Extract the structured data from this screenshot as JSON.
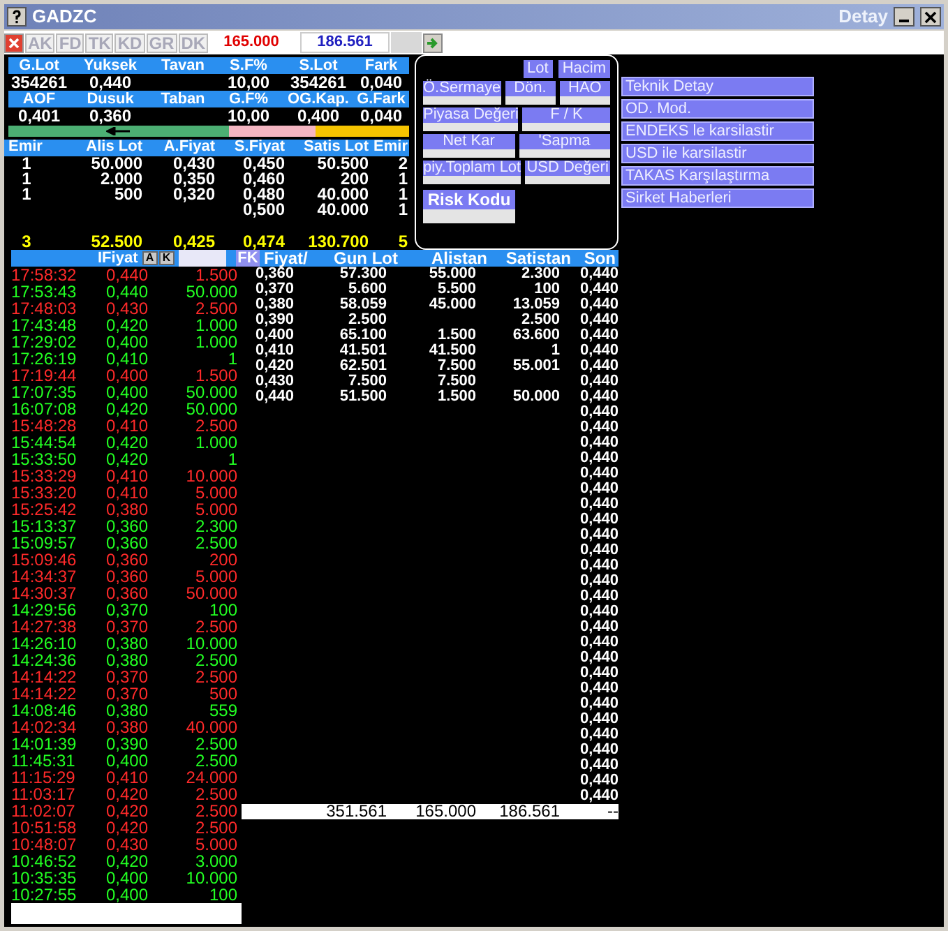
{
  "window": {
    "title": "GADZC",
    "subtitle": "Detay"
  },
  "toolbar": {
    "buttons": [
      {
        "label": "AK",
        "disabled": true
      },
      {
        "label": "FD",
        "disabled": true
      },
      {
        "label": "TK",
        "disabled": true
      },
      {
        "label": "KD",
        "disabled": true
      },
      {
        "label": "GR",
        "disabled": true
      },
      {
        "label": "DK",
        "disabled": true
      }
    ],
    "sell_total": "165.000",
    "buy_total": "186.561"
  },
  "summary": [
    {
      "columns": [
        {
          "header": "G.Lot",
          "value": "354261"
        },
        {
          "header": "Yuksek",
          "value": "0,440"
        },
        {
          "header": "Tavan"
        },
        {
          "header": "S.F%",
          "value": "10,00"
        },
        {
          "header": "S.Lot",
          "value": "354261"
        },
        {
          "header": "Fark",
          "value": "0,040"
        }
      ]
    },
    {
      "columns": [
        {
          "header": "AOF",
          "value": "0,401"
        },
        {
          "header": "Dusuk",
          "value": "0,360"
        },
        {
          "header": "Taban"
        },
        {
          "header": "G.F%",
          "value": "10,00"
        },
        {
          "header": "OG.Kap.",
          "value": "0,400"
        },
        {
          "header": "G.Fark",
          "value": "0,040"
        }
      ]
    }
  ],
  "range_bar": {
    "segments": [
      {
        "color": "#4caf73"
      },
      {
        "color": "#f4b6c2"
      },
      {
        "color": "#f5c400"
      }
    ]
  },
  "order_book": {
    "columns": [
      "Emir",
      "Alis Lot",
      "A.Fiyat",
      "S.Fiyat",
      "Satis Lot",
      "Emir"
    ],
    "rows": [
      {
        "buy_orders": "1",
        "buy_lot": "50.000",
        "buy_price": "0,430",
        "sell_price": "0,450",
        "sell_lot": "50.500",
        "sell_orders": "2"
      },
      {
        "buy_orders": "1",
        "buy_lot": "2.000",
        "buy_price": "0,350",
        "sell_price": "0,460",
        "sell_lot": "200",
        "sell_orders": "1"
      },
      {
        "buy_orders": "1",
        "buy_lot": "500",
        "buy_price": "0,320",
        "sell_price": "0,480",
        "sell_lot": "40.000",
        "sell_orders": "1"
      },
      {
        "sell_price": "0,500",
        "sell_lot": "40.000",
        "sell_orders": "1"
      }
    ],
    "totals": [
      "3",
      "52.500",
      "0,425",
      "0,474",
      "130.700",
      "5"
    ]
  },
  "detail_panel": {
    "buttons": [
      "Lot",
      "Hacim"
    ],
    "rows": [
      [
        {
          "label": "Ö.Sermaye"
        },
        {
          "label": "Dön."
        },
        {
          "label": "HAO"
        }
      ],
      [
        {
          "label": "Piyasa Değeri"
        },
        {
          "label": "F / K"
        }
      ],
      [
        {
          "label": "Net Kar"
        },
        {
          "label": "'Sapma"
        }
      ],
      [
        {
          "label": "piy.Toplam Lot"
        },
        {
          "label": "USD Değeri"
        }
      ],
      [
        {
          "label": "Risk Kodu"
        }
      ]
    ]
  },
  "menu": [
    "Teknik Detay",
    "OD. Mod.",
    "ENDEKS le karsilastir",
    "USD ile karsilastir",
    "TAKAS Karşılaştırma",
    "Sirket Haberleri"
  ],
  "trades": {
    "header": "IFiyat",
    "buttons": [
      "A",
      "K"
    ],
    "filter_button": "FK",
    "rows": [
      {
        "time": "17:58:32",
        "price": "0,440",
        "qty": "1.500",
        "color": "#ff2a2a"
      },
      {
        "time": "17:53:43",
        "price": "0,440",
        "qty": "50.000",
        "color": "#22ff22"
      },
      {
        "time": "17:48:03",
        "price": "0,430",
        "qty": "2.500",
        "color": "#ff2a2a"
      },
      {
        "time": "17:43:48",
        "price": "0,420",
        "qty": "1.000",
        "color": "#22ff22"
      },
      {
        "time": "17:29:02",
        "price": "0,400",
        "qty": "1.000",
        "color": "#22ff22"
      },
      {
        "time": "17:26:19",
        "price": "0,410",
        "qty": "1",
        "color": "#22ff22"
      },
      {
        "time": "17:19:44",
        "price": "0,400",
        "qty": "1.500",
        "color": "#ff2a2a"
      },
      {
        "time": "17:07:35",
        "price": "0,400",
        "qty": "50.000",
        "color": "#22ff22"
      },
      {
        "time": "16:07:08",
        "price": "0,420",
        "qty": "50.000",
        "color": "#22ff22"
      },
      {
        "time": "15:48:28",
        "price": "0,410",
        "qty": "2.500",
        "color": "#ff2a2a"
      },
      {
        "time": "15:44:54",
        "price": "0,420",
        "qty": "1.000",
        "color": "#22ff22"
      },
      {
        "time": "15:33:50",
        "price": "0,420",
        "qty": "1",
        "color": "#22ff22"
      },
      {
        "time": "15:33:29",
        "price": "0,410",
        "qty": "10.000",
        "color": "#ff2a2a"
      },
      {
        "time": "15:33:20",
        "price": "0,410",
        "qty": "5.000",
        "color": "#ff2a2a"
      },
      {
        "time": "15:25:42",
        "price": "0,380",
        "qty": "5.000",
        "color": "#ff2a2a"
      },
      {
        "time": "15:13:37",
        "price": "0,360",
        "qty": "2.300",
        "color": "#22ff22"
      },
      {
        "time": "15:09:57",
        "price": "0,360",
        "qty": "2.500",
        "color": "#22ff22"
      },
      {
        "time": "15:09:46",
        "price": "0,360",
        "qty": "200",
        "color": "#ff2a2a"
      },
      {
        "time": "14:34:37",
        "price": "0,360",
        "qty": "5.000",
        "color": "#ff2a2a"
      },
      {
        "time": "14:30:37",
        "price": "0,360",
        "qty": "50.000",
        "color": "#ff2a2a"
      },
      {
        "time": "14:29:56",
        "price": "0,370",
        "qty": "100",
        "color": "#22ff22"
      },
      {
        "time": "14:27:38",
        "price": "0,370",
        "qty": "2.500",
        "color": "#ff2a2a"
      },
      {
        "time": "14:26:10",
        "price": "0,380",
        "qty": "10.000",
        "color": "#22ff22"
      },
      {
        "time": "14:24:36",
        "price": "0,380",
        "qty": "2.500",
        "color": "#22ff22"
      },
      {
        "time": "14:14:22",
        "price": "0,370",
        "qty": "2.500",
        "color": "#ff2a2a"
      },
      {
        "time": "14:14:22",
        "price": "0,370",
        "qty": "500",
        "color": "#ff2a2a"
      },
      {
        "time": "14:08:46",
        "price": "0,380",
        "qty": "559",
        "color": "#22ff22"
      },
      {
        "time": "14:02:34",
        "price": "0,380",
        "qty": "40.000",
        "color": "#ff2a2a"
      },
      {
        "time": "14:01:39",
        "price": "0,390",
        "qty": "2.500",
        "color": "#22ff22"
      },
      {
        "time": "11:45:31",
        "price": "0,400",
        "qty": "2.500",
        "color": "#22ff22"
      },
      {
        "time": "11:15:29",
        "price": "0,410",
        "qty": "24.000",
        "color": "#ff2a2a"
      },
      {
        "time": "11:03:17",
        "price": "0,420",
        "qty": "2.500",
        "color": "#ff2a2a"
      },
      {
        "time": "11:02:07",
        "price": "0,420",
        "qty": "2.500",
        "color": "#ff2a2a"
      },
      {
        "time": "10:51:58",
        "price": "0,420",
        "qty": "2.500",
        "color": "#ff2a2a"
      },
      {
        "time": "10:48:07",
        "price": "0,430",
        "qty": "5.000",
        "color": "#ff2a2a"
      },
      {
        "time": "10:46:52",
        "price": "0,420",
        "qty": "3.000",
        "color": "#22ff22"
      },
      {
        "time": "10:35:35",
        "price": "0,400",
        "qty": "10.000",
        "color": "#22ff22"
      },
      {
        "time": "10:27:55",
        "price": "0,400",
        "qty": "100",
        "color": "#22ff22"
      }
    ]
  },
  "price_table": {
    "columns": [
      "Fiyat/",
      "Gun Lot",
      "Alistan",
      "Satistan",
      "Son"
    ],
    "rows": [
      {
        "price": "0,360",
        "day_lot": "57.300",
        "bought": "55.000",
        "sold": "2.300"
      },
      {
        "price": "0,370",
        "day_lot": "5.600",
        "bought": "5.500",
        "sold": "100"
      },
      {
        "price": "0,380",
        "day_lot": "58.059",
        "bought": "45.000",
        "sold": "13.059"
      },
      {
        "price": "0,390",
        "day_lot": "2.500",
        "sold": "2.500"
      },
      {
        "price": "0,400",
        "day_lot": "65.100",
        "bought": "1.500",
        "sold": "63.600"
      },
      {
        "price": "0,410",
        "day_lot": "41.501",
        "bought": "41.500",
        "sold": "1"
      },
      {
        "price": "0,420",
        "day_lot": "62.501",
        "bought": "7.500",
        "sold": "55.001"
      },
      {
        "price": "0,430",
        "day_lot": "7.500",
        "bought": "7.500"
      },
      {
        "price": "0,440",
        "day_lot": "51.500",
        "bought": "1.500",
        "sold": "50.000"
      }
    ],
    "last_prices": [
      "0,440",
      "0,440",
      "0,440",
      "0,440",
      "0,440",
      "0,440",
      "0,440",
      "0,440",
      "0,440",
      "0,440",
      "0,440",
      "0,440",
      "0,440",
      "0,440",
      "0,440",
      "0,440",
      "0,440",
      "0,440",
      "0,440",
      "0,440",
      "0,440",
      "0,440",
      "0,440",
      "0,440",
      "0,440",
      "0,440",
      "0,440",
      "0,440",
      "0,440",
      "0,440",
      "0,440",
      "0,440",
      "0,440",
      "0,440",
      "0,440"
    ],
    "totals": [
      "351.561",
      "165.000",
      "186.561",
      "--"
    ]
  }
}
